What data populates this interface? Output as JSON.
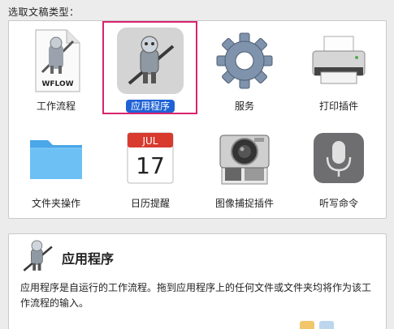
{
  "prompt": "选取文稿类型：",
  "types": [
    {
      "label": "工作流程",
      "icon": "workflow-document-icon",
      "badge": "WFLOW"
    },
    {
      "label": "应用程序",
      "icon": "automator-robot-icon",
      "selected": true
    },
    {
      "label": "服务",
      "icon": "gear-icon"
    },
    {
      "label": "打印插件",
      "icon": "printer-icon"
    },
    {
      "label": "文件夹操作",
      "icon": "folder-icon"
    },
    {
      "label": "日历提醒",
      "icon": "calendar-icon",
      "cal_month": "JUL",
      "cal_day": "17"
    },
    {
      "label": "图像捕捉插件",
      "icon": "camera-icon"
    },
    {
      "label": "听写命令",
      "icon": "microphone-icon"
    }
  ],
  "description": {
    "title": "应用程序",
    "text": "应用程序是自运行的工作流程。拖到应用程序上的任何文件或文件夹均将作为该工作流程的输入。"
  },
  "colors": {
    "selection": "#1f62d6",
    "highlight": "#d9246e",
    "folder": "#5bb4ef"
  }
}
